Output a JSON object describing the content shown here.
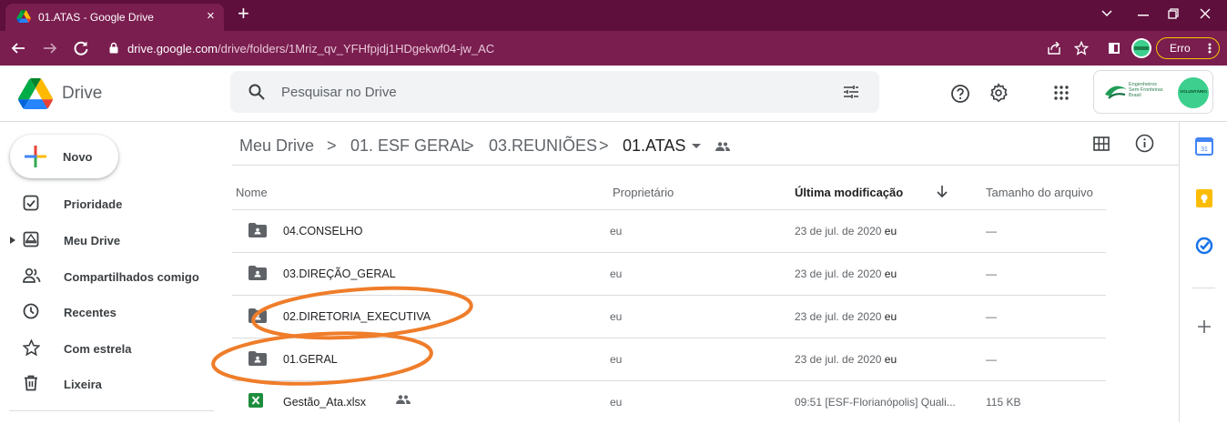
{
  "browser": {
    "tab_title": "01.ATAS - Google Drive",
    "tab_close": "×",
    "new_tab": "+",
    "url_host": "drive.google.com",
    "url_path": "/drive/folders/1Mriz_qv_YFHfpjdj1HDgekwf04-jw_AC",
    "profile_status": "Erro",
    "colors": {
      "tab_bar": "#5e0f3c",
      "toolbar": "#7a1d4f"
    }
  },
  "header": {
    "app_name": "Drive",
    "search_placeholder": "Pesquisar no Drive",
    "org_name_line1": "Engenheiros",
    "org_name_line2": "Sem Fronteiras",
    "org_name_line3": "Brasil",
    "avatar_text": "VOLUNTÁRIO"
  },
  "sidebar": {
    "new_label": "Novo",
    "items": [
      {
        "label": "Prioridade",
        "icon": "priority-check-icon"
      },
      {
        "label": "Meu Drive",
        "icon": "my-drive-icon"
      },
      {
        "label": "Compartilhados comigo",
        "icon": "shared-people-icon"
      },
      {
        "label": "Recentes",
        "icon": "clock-icon"
      },
      {
        "label": "Com estrela",
        "icon": "star-icon"
      },
      {
        "label": "Lixeira",
        "icon": "trash-icon"
      }
    ]
  },
  "breadcrumb": {
    "items": [
      "Meu Drive",
      "01. ESF GERAL",
      "03.REUNIÕES",
      "01.ATAS"
    ],
    "separator": ">"
  },
  "table": {
    "columns": {
      "name": "Nome",
      "owner": "Proprietário",
      "modified": "Última modificação",
      "size": "Tamanho do arquivo"
    },
    "sort_direction": "descending",
    "rows": [
      {
        "type": "shared-folder",
        "name": "04.CONSELHO",
        "owner": "eu",
        "modified_date": "23 de jul. de 2020",
        "modified_by": "eu",
        "size": "—"
      },
      {
        "type": "shared-folder",
        "name": "03.DIREÇÃO_GERAL",
        "owner": "eu",
        "modified_date": "23 de jul. de 2020",
        "modified_by": "eu",
        "size": "—"
      },
      {
        "type": "shared-folder",
        "name": "02.DIRETORIA_EXECUTIVA",
        "owner": "eu",
        "modified_date": "23 de jul. de 2020",
        "modified_by": "eu",
        "size": "—"
      },
      {
        "type": "shared-folder",
        "name": "01.GERAL",
        "owner": "eu",
        "modified_date": "23 de jul. de 2020",
        "modified_by": "eu",
        "size": "—"
      },
      {
        "type": "spreadsheet",
        "name": "Gestão_Ata.xlsx",
        "owner": "eu",
        "modified_date": "09:51",
        "modified_by": "[ESF-Florianópolis] Quali...",
        "size": "115 KB"
      }
    ]
  },
  "annotations": {
    "circle_color": "#ef7d2a"
  }
}
